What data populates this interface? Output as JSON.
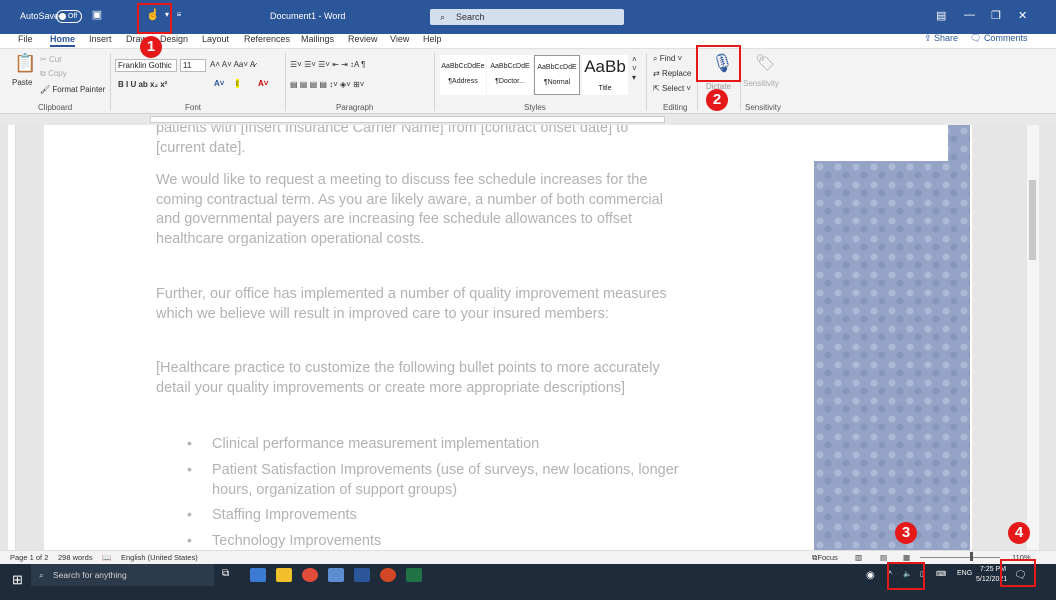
{
  "titlebar": {
    "autosave_label": "AutoSave",
    "autosave_state": "Off",
    "doc_title": "Document1 - Word",
    "search_placeholder": "Search"
  },
  "tabs": [
    "File",
    "Home",
    "Insert",
    "Draw",
    "Design",
    "Layout",
    "References",
    "Mailings",
    "Review",
    "View",
    "Help"
  ],
  "active_tab": "Home",
  "share_label": "Share",
  "comments_label": "Comments",
  "ribbon": {
    "clipboard": {
      "paste": "Paste",
      "cut": "Cut",
      "copy": "Copy",
      "format_painter": "Format Painter",
      "label": "Clipboard"
    },
    "font": {
      "font_name": "Franklin Gothic",
      "font_size": "11",
      "label": "Font"
    },
    "paragraph": {
      "label": "Paragraph"
    },
    "styles": {
      "items": [
        {
          "preview": "AaBbCcDdEe",
          "name": "¶Address"
        },
        {
          "preview": "AaBbCcDdE",
          "name": "¶Doctor..."
        },
        {
          "preview": "AaBbCcDdE",
          "name": "¶Normal"
        },
        {
          "preview": "AaBb",
          "name": "Title"
        }
      ],
      "label": "Styles"
    },
    "editing": {
      "find": "Find",
      "replace": "Replace",
      "select": "Select",
      "label": "Editing"
    },
    "voice": {
      "dictate": "Dictate",
      "label": "Voice"
    },
    "sensitivity": {
      "button": "Sensitivity",
      "label": "Sensitivity"
    }
  },
  "document": {
    "para1": "patients with [Insert Insurance Carrier Name] from [contract onset date] to [current date].",
    "para2": "We would like to request a meeting to discuss fee schedule increases for the coming contractual term. As you are likely aware, a number of both commercial and governmental payers are increasing fee schedule allowances to offset healthcare organization operational costs.",
    "para3": "Further, our office has implemented a number of quality improvement measures which we believe will result in improved care to your insured members:",
    "para4": "[Healthcare practice to customize the following bullet points to more accurately detail your quality improvements or create more appropriate descriptions]",
    "bullets": [
      "Clinical performance measurement implementation",
      "Patient Satisfaction Improvements (use of surveys, new locations, longer hours, organization of support groups)",
      "Staffing Improvements",
      "Technology Improvements"
    ]
  },
  "statusbar": {
    "page": "Page 1 of 2",
    "words": "298 words",
    "language": "English (United States)",
    "focus": "Focus",
    "zoom": "110%"
  },
  "taskbar": {
    "search_placeholder": "Search for anything",
    "time": "7:25 PM",
    "date": "5/12/2021",
    "lang": "ENG"
  },
  "annotations": [
    "1",
    "2",
    "3",
    "4"
  ]
}
